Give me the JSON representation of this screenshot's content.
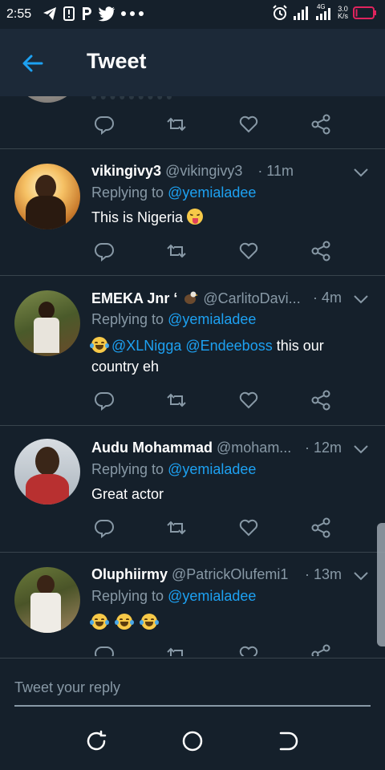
{
  "status_bar": {
    "time": "2:55",
    "network": "4G",
    "speed_value": "3.0",
    "speed_unit": "K/s",
    "left_icons": [
      "telegram-icon",
      "notification-icon",
      "p-icon",
      "twitter-icon",
      "more-dots-icon"
    ],
    "right_icons": [
      "alarm-icon",
      "signal-icon",
      "signal-4g-icon",
      "battery-low-icon"
    ]
  },
  "appbar": {
    "title": "Tweet"
  },
  "colors": {
    "background": "#15202b",
    "accent": "#1da1f2",
    "muted": "#8899a6",
    "battery": "#e0245e"
  },
  "tweets": [
    {
      "name": "vikingivy3",
      "handle": "@vikingivy3",
      "time": "· 11m",
      "replying_prefix": "Replying to",
      "replying_to": "@yemialadee",
      "text": "This is Nigeria"
    },
    {
      "name": "EMEKA Jnr ‘",
      "handle": "@CarlitoDavi...",
      "time": "· 4m",
      "replying_prefix": "Replying to",
      "replying_to": "@yemialadee",
      "mention1": "@XLNigga",
      "mention2": "@Endeeboss",
      "text_rest": "this our country eh"
    },
    {
      "name": "Audu Mohammad",
      "handle": "@moham...",
      "time": "· 12m",
      "replying_prefix": "Replying to",
      "replying_to": "@yemialadee",
      "text": "Great actor"
    },
    {
      "name": "Oluphiirmy",
      "handle": "@PatrickOlufemi1",
      "time": "· 13m",
      "replying_prefix": "Replying to",
      "replying_to": "@yemialadee"
    }
  ],
  "reply_bar": {
    "placeholder": "Tweet your reply"
  }
}
